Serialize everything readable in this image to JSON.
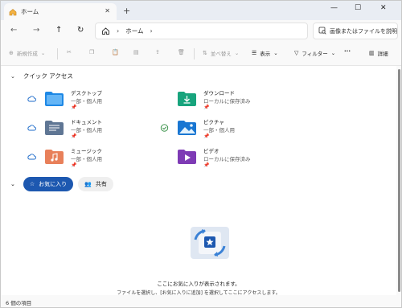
{
  "colors": {
    "accent": "#1d58b0",
    "titlebar_bg": "#e9edf3",
    "content_bg": "#ffffff"
  },
  "tab": {
    "label": "ホーム",
    "icon": "home-icon",
    "close_icon": "close-icon"
  },
  "new_tab_icon": "plus-icon",
  "window_controls": [
    "minimize-icon",
    "maximize-icon",
    "close-icon"
  ],
  "nav": {
    "buttons": [
      "back-icon",
      "forward-icon",
      "up-icon",
      "refresh-icon"
    ],
    "breadcrumb": {
      "root_icon": "home-icon",
      "items": [
        "ホーム"
      ]
    },
    "search_placeholder": "画像またはファイルを説明"
  },
  "commands": {
    "new": "新規作成",
    "sort": "並べ替え",
    "view": "表示",
    "filter": "フィルター",
    "more": "...",
    "details": "詳細"
  },
  "quick_access": {
    "title": "クイック アクセス",
    "items": [
      {
        "name": "デスクトップ",
        "status": "一部・個人用",
        "sync": "cloud",
        "folder": "desktop"
      },
      {
        "name": "ダウンロード",
        "status": "ローカルに保存済み",
        "sync": "none",
        "folder": "downloads"
      },
      {
        "name": "ドキュメント",
        "status": "一部・個人用",
        "sync": "cloud",
        "folder": "documents"
      },
      {
        "name": "ピクチャ",
        "status": "一部・個人用",
        "sync": "check",
        "folder": "pictures"
      },
      {
        "name": "ミュージック",
        "status": "一部・個人用",
        "sync": "cloud",
        "folder": "music"
      },
      {
        "name": "ビデオ",
        "status": "ローカルに保存済み",
        "sync": "none",
        "folder": "videos"
      }
    ]
  },
  "favorites": {
    "tabs": [
      {
        "label": "お気に入り",
        "icon": "star-icon",
        "active": true
      },
      {
        "label": "共有",
        "icon": "people-icon",
        "active": false
      }
    ],
    "empty_title": "ここにお気に入りが表示されます。",
    "empty_message": "ファイルを選択し、[お気に入りに追加] を選択してここにアクセスします。"
  },
  "status": {
    "item_count": "6 個の項目"
  }
}
